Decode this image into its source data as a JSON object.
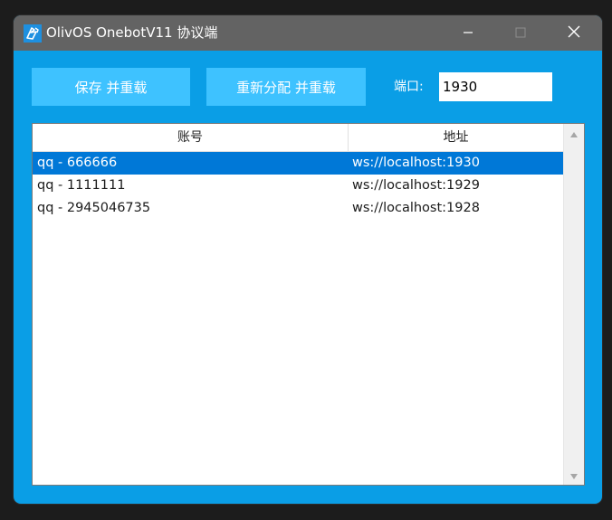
{
  "window": {
    "title": "OlivOS OnebotV11 协议端"
  },
  "toolbar": {
    "save_label": "保存 并重载",
    "realloc_label": "重新分配 并重载",
    "port_label": "端口:",
    "port_value": "1930"
  },
  "table": {
    "headers": {
      "account": "账号",
      "address": "地址"
    },
    "rows": [
      {
        "account": "qq - 666666",
        "address": "ws://localhost:1930",
        "selected": true
      },
      {
        "account": "qq - 1111111",
        "address": "ws://localhost:1929",
        "selected": false
      },
      {
        "account": "qq - 2945046735",
        "address": "ws://localhost:1928",
        "selected": false
      }
    ]
  },
  "icons": {
    "app": "olivos-app-icon",
    "minimize": "minimize-icon",
    "maximize": "maximize-icon",
    "close": "close-icon",
    "scroll_up": "scroll-up-arrow-icon",
    "scroll_down": "scroll-down-arrow-icon"
  },
  "colors": {
    "window_bg": "#0a9ee6",
    "titlebar_bg": "#636363",
    "button_bg": "#3ec2ff",
    "selection": "#0078d7"
  }
}
